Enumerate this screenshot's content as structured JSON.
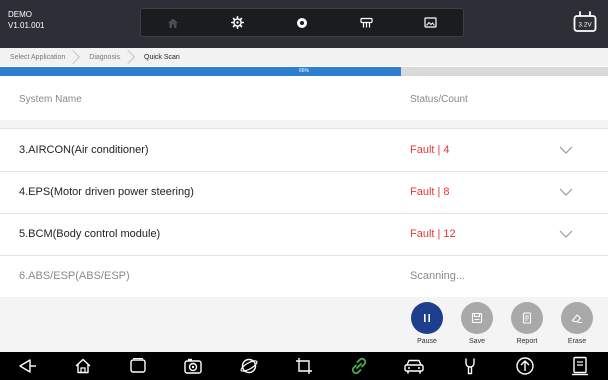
{
  "header": {
    "title": "DEMO",
    "version": "V1.01.001"
  },
  "toolbar": {
    "items": [
      {
        "icon": "home-icon"
      },
      {
        "icon": "gear-icon"
      },
      {
        "icon": "record-icon"
      },
      {
        "icon": "vci-icon"
      },
      {
        "icon": "image-icon"
      }
    ]
  },
  "battery": {
    "voltage": "3.2V"
  },
  "breadcrumb": [
    "Select Application",
    "Diagnosis",
    "Quick Scan"
  ],
  "progress": {
    "value": 0.66,
    "label": "66%"
  },
  "table": {
    "columns": {
      "name": "System Name",
      "status": "Status/Count"
    },
    "rows": [
      {
        "name": "3.AIRCON(Air conditioner)",
        "status": "Fault | 4"
      },
      {
        "name": "4.EPS(Motor driven power steering)",
        "status": "Fault | 8"
      },
      {
        "name": "5.BCM(Body control module)",
        "status": "Fault | 12"
      },
      {
        "name": "6.ABS/ESP(ABS/ESP)",
        "status": "Scanning..."
      }
    ]
  },
  "actions": [
    {
      "label": "Pause",
      "icon": "pause-icon"
    },
    {
      "label": "Save",
      "icon": "save-icon"
    },
    {
      "label": "Report",
      "icon": "report-icon"
    },
    {
      "label": "Erase",
      "icon": "erase-icon"
    }
  ],
  "navbar": {
    "items": [
      "back-icon",
      "home-icon",
      "recent-apps-icon",
      "camera-icon",
      "browser-icon",
      "crop-icon",
      "link-icon",
      "car-icon",
      "tools-icon",
      "upload-icon",
      "document-icon"
    ]
  },
  "colors": {
    "topbar": "#2c2f36",
    "accent": "#2f7fd0",
    "fault": "#e53935",
    "primary_button": "#1e3f8e",
    "link_icon": "#4caf50"
  }
}
